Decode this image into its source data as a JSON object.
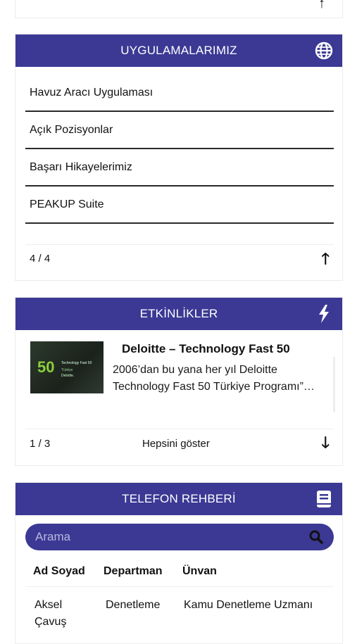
{
  "top_card": {
    "arrow_icon": "arrow-up-icon"
  },
  "apps": {
    "title": "UYGULAMALARIMIZ",
    "icon": "globe-icon",
    "items": [
      {
        "label": "Havuz Aracı Uygulaması"
      },
      {
        "label": "Açık Pozisyonlar"
      },
      {
        "label": "Başarı Hikayelerimiz"
      },
      {
        "label": "PEAKUP Suite"
      }
    ],
    "pager": {
      "count": "4 / 4",
      "icon": "arrow-up-icon"
    }
  },
  "events": {
    "title": "ETKİNLİKLER",
    "icon": "lightning-icon",
    "item": {
      "title": "Deloitte – Technology Fast 50",
      "desc_line1": "2006’dan bu yana her yıl Deloitte",
      "desc_line2": "Technology Fast 50 Türkiye Programı”…",
      "thumb_number": "50",
      "thumb_text1": "Technology Fast 50",
      "thumb_text2": "Türkiye",
      "thumb_text3": "Deloitte."
    },
    "pager": {
      "count": "1 / 3",
      "show_all": "Hepsini göster",
      "icon": "arrow-down-icon"
    }
  },
  "phone": {
    "title": "TELEFON REHBERİ",
    "icon": "book-icon",
    "search": {
      "placeholder": "Arama",
      "value": "",
      "icon": "search-icon"
    },
    "columns": [
      "Ad Soyad",
      "Departman",
      "Ünvan"
    ],
    "rows": [
      {
        "name_line1": "Aksel",
        "name_line2": "Çavuş",
        "department": "Denetleme",
        "title": "Kamu Denetleme Uzmanı"
      }
    ]
  },
  "colors": {
    "header": "#3b3994",
    "text": "#111111"
  }
}
